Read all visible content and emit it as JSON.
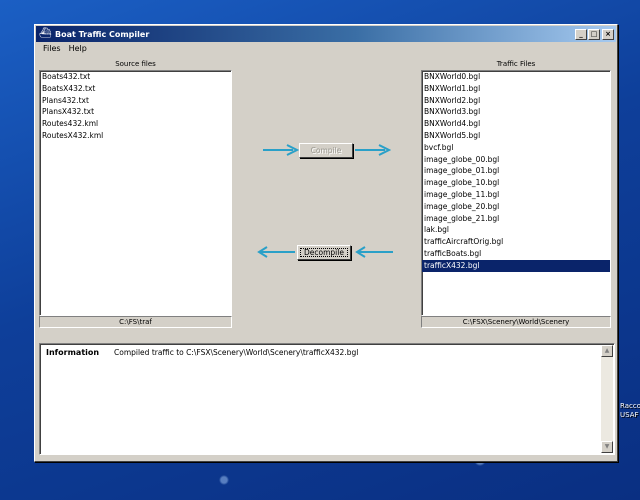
{
  "window": {
    "title": "Boat Traffic Compiler",
    "controls": {
      "minimize": "_",
      "maximize": "□",
      "close": "×"
    }
  },
  "menu": [
    "Files",
    "Help"
  ],
  "source_panel": {
    "title": "Source files",
    "items": [
      "Boats432.txt",
      "BoatsX432.txt",
      "Plans432.txt",
      "PlansX432.txt",
      "Routes432.kml",
      "RoutesX432.kml"
    ],
    "path": "C:\\FS\\traf"
  },
  "traffic_panel": {
    "title": "Traffic Files",
    "items": [
      "BNXWorld0.bgl",
      "BNXWorld1.bgl",
      "BNXWorld2.bgl",
      "BNXWorld3.bgl",
      "BNXWorld4.bgl",
      "BNXWorld5.bgl",
      "bvcf.bgl",
      "image_globe_00.bgl",
      "image_globe_01.bgl",
      "image_globe_10.bgl",
      "image_globe_11.bgl",
      "image_globe_20.bgl",
      "image_globe_21.bgl",
      "lak.bgl",
      "trafficAircraftOrig.bgl",
      "trafficBoats.bgl",
      "trafficX432.bgl"
    ],
    "selected_index": 16,
    "path": "C:\\FSX\\Scenery\\World\\Scenery"
  },
  "actions": {
    "compile_label": "Compile",
    "decompile_label": "Decompile",
    "arrow_color": "#2aa0c8"
  },
  "info": {
    "label": "Information",
    "message": "Compiled traffic to C:\\FSX\\Scenery\\World\\Scenery\\trafficX432.bgl"
  },
  "desktop": {
    "icon_label_lines": [
      "Racco",
      "USAF"
    ]
  }
}
